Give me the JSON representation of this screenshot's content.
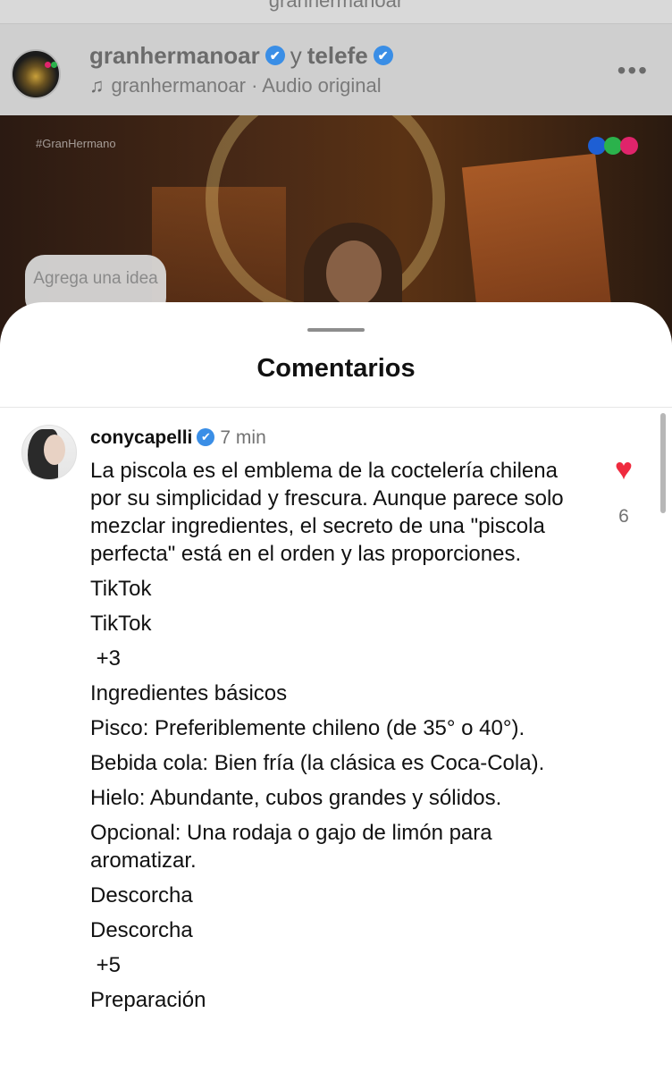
{
  "top_username": "granhermanoar",
  "post": {
    "author": "granhermanoar",
    "conjunction": "y",
    "collaborator": "telefe",
    "audio_author": "granhermanoar",
    "audio_sep": "·",
    "audio_label": "Audio original",
    "more_label": "•••",
    "verified_glyph": "✔"
  },
  "video": {
    "hashtag": "#GranHermano",
    "idea_chip": "Agrega una idea",
    "logo_colors": [
      "#1e5fd4",
      "#2bb24c",
      "#e0246b"
    ]
  },
  "sheet": {
    "title": "Comentarios"
  },
  "comment": {
    "username": "conycapelli",
    "verified_glyph": "✔",
    "time": "7 min",
    "likes": "6",
    "heart": "♥",
    "heart_color": "#ef2a3e",
    "lines": [
      "La piscola es el emblema de la coctelería chilena por su simplicidad y frescura. Aunque parece solo mezclar ingredientes, el secreto de una \"piscola perfecta\" está en el orden y las proporciones.",
      "TikTok",
      "TikTok",
      " +3",
      "Ingredientes básicos",
      "Pisco: Preferiblemente chileno (de 35° o 40°).",
      "Bebida cola: Bien fría (la clásica es Coca-Cola).",
      "Hielo: Abundante, cubos grandes y sólidos.",
      "Opcional: Una rodaja o gajo de limón para aromatizar.",
      "Descorcha",
      "Descorcha",
      " +5",
      "Preparación"
    ]
  }
}
